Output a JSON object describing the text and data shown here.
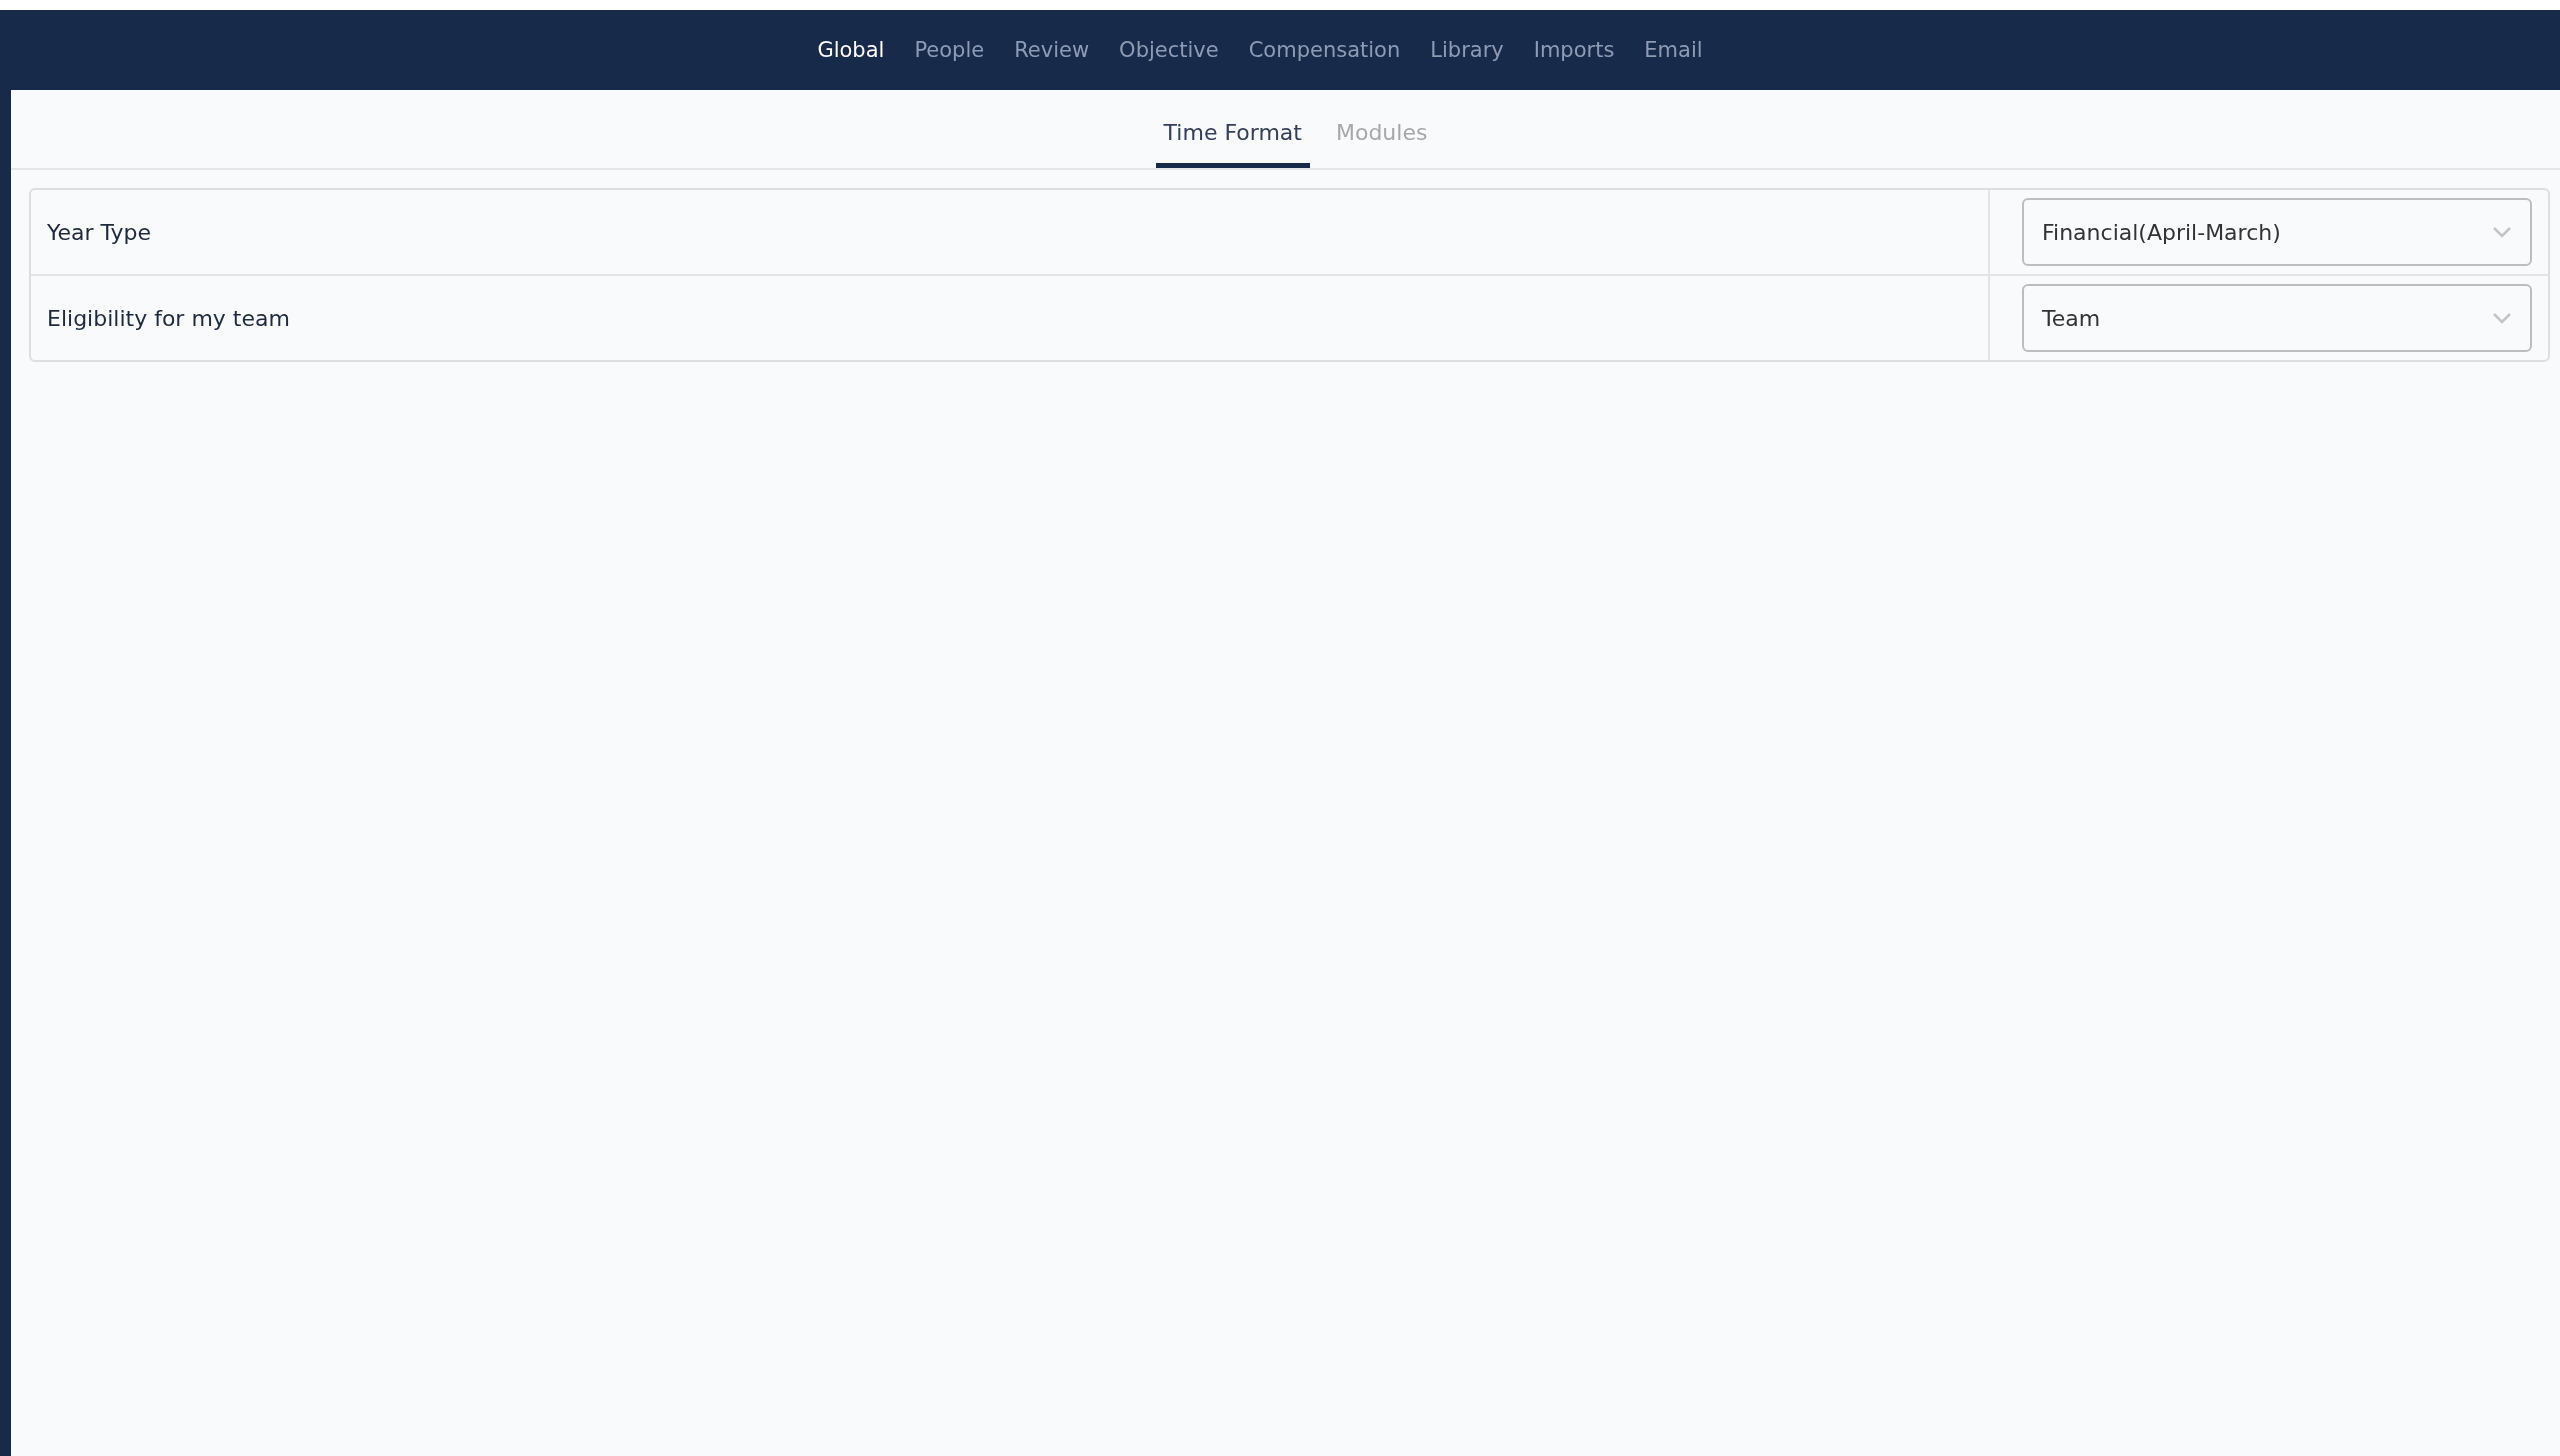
{
  "nav": [
    {
      "label": "Global",
      "selected": true
    },
    {
      "label": "People",
      "selected": false
    },
    {
      "label": "Review",
      "selected": false
    },
    {
      "label": "Objective",
      "selected": false
    },
    {
      "label": "Compensation",
      "selected": false
    },
    {
      "label": "Library",
      "selected": false
    },
    {
      "label": "Imports",
      "selected": false
    },
    {
      "label": "Email",
      "selected": false
    }
  ],
  "tabs": [
    {
      "label": "Time Format",
      "selected": true
    },
    {
      "label": "Modules",
      "selected": false
    }
  ],
  "settings": [
    {
      "label": "Year Type",
      "value": "Financial(April-March)"
    },
    {
      "label": "Eligibility for my team",
      "value": "Team"
    }
  ]
}
